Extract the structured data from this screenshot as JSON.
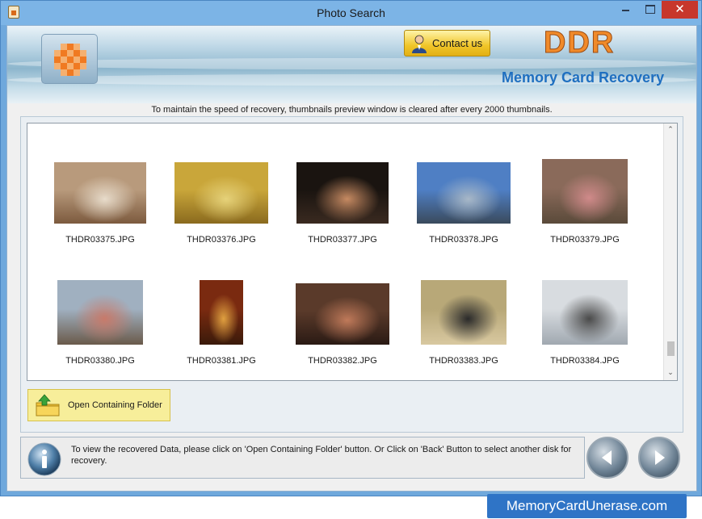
{
  "window": {
    "title": "Photo Search",
    "close_glyph": "✕"
  },
  "banner": {
    "contact_label": "Contact us",
    "brand": "DDR",
    "product": "Memory Card Recovery"
  },
  "notice": "To maintain the speed of recovery, thumbnails preview window is cleared after every 2000 thumbnails.",
  "thumbnails": [
    {
      "name": "THDR03375.JPG",
      "palette": [
        "#b89a7c",
        "#e8dccb",
        "#7c5a3e"
      ]
    },
    {
      "name": "THDR03376.JPG",
      "palette": [
        "#c9a63a",
        "#e6d27a",
        "#8a6a1e"
      ]
    },
    {
      "name": "THDR03377.JPG",
      "palette": [
        "#1a1410",
        "#c68a62",
        "#3a2a20"
      ]
    },
    {
      "name": "THDR03378.JPG",
      "palette": [
        "#4f7fc4",
        "#a8b8c8",
        "#3a4a5c"
      ]
    },
    {
      "name": "THDR03379.JPG",
      "palette": [
        "#8a6a5a",
        "#d08a8a",
        "#5a4a3a"
      ]
    },
    {
      "name": "THDR03380.JPG",
      "palette": [
        "#a0b0c0",
        "#c87a6a",
        "#6a5a4a"
      ]
    },
    {
      "name": "THDR03381.JPG",
      "palette": [
        "#7a2a10",
        "#e0a040",
        "#3a1a0a"
      ]
    },
    {
      "name": "THDR03382.JPG",
      "palette": [
        "#5a3a2a",
        "#c07a5a",
        "#2a1a14"
      ]
    },
    {
      "name": "THDR03383.JPG",
      "palette": [
        "#b8a878",
        "#2a2a2a",
        "#d8c8a0"
      ]
    },
    {
      "name": "THDR03384.JPG",
      "palette": [
        "#d8dce0",
        "#4a4a4a",
        "#a0a8b0"
      ]
    }
  ],
  "scroll_up_glyph": "⌃",
  "scroll_down_glyph": "⌄",
  "open_folder_label": "Open Containing Folder",
  "footer_text": "To view the recovered Data, please click on 'Open Containing Folder' button. Or Click on 'Back' Button to select another disk for recovery.",
  "watermark": "MemoryCardUnerase.com"
}
